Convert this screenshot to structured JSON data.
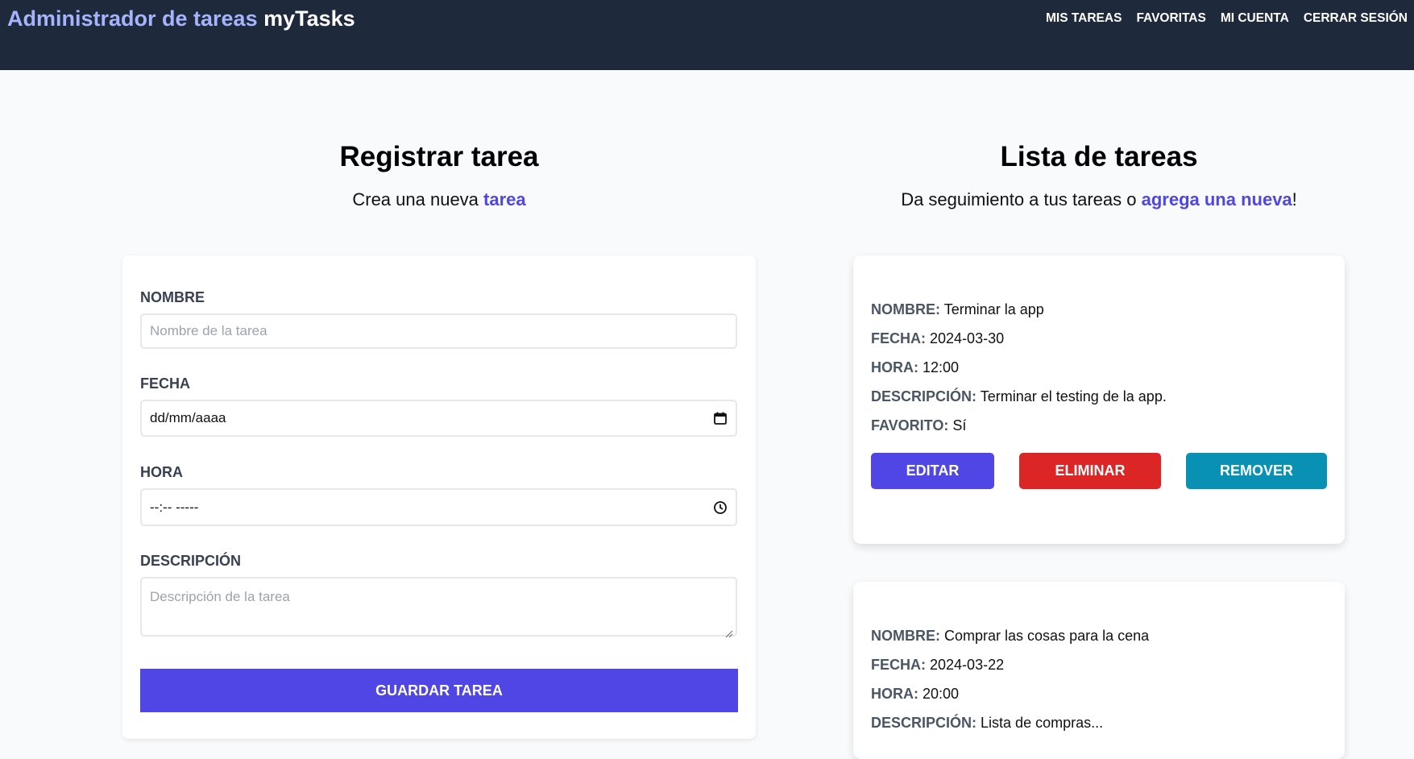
{
  "header": {
    "brand_prefix": "Administrador de tareas",
    "brand_name": "myTasks",
    "nav": [
      "Mis tareas",
      "Favoritas",
      "Mi cuenta",
      "Cerrar sesión"
    ]
  },
  "form_section": {
    "title": "Registrar tarea",
    "subtitle_prefix": "Crea una nueva",
    "subtitle_link": "tarea",
    "fields": {
      "name_label": "Nombre",
      "name_placeholder": "Nombre de la tarea",
      "date_label": "Fecha",
      "date_value": "dd/mm/aaaa",
      "time_label": "Hora",
      "time_value": "--:-- -----",
      "description_label": "Descripción",
      "description_placeholder": "Descripción de la tarea"
    },
    "save_label": "Guardar tarea"
  },
  "list_section": {
    "title": "Lista de tareas",
    "subtitle_prefix": "Da seguimiento a tus tareas o",
    "subtitle_link": "agrega una nueva",
    "subtitle_suffix": "!",
    "keys": {
      "name": "Nombre:",
      "date": "Fecha:",
      "time": "Hora:",
      "description": "Descripción:",
      "favorite": "Favorito:"
    },
    "tasks": [
      {
        "name": "Terminar la app",
        "date": "2024-03-30",
        "time": "12:00",
        "description": "Terminar el testing de la app.",
        "favorite": "Sí"
      },
      {
        "name": "Comprar las cosas para la cena",
        "date": "2024-03-22",
        "time": "20:00",
        "description": "Lista de compras..."
      }
    ],
    "buttons": {
      "edit": "Editar",
      "delete": "Eliminar",
      "remove": "Remover"
    }
  },
  "colors": {
    "header_bg": "#1e293b",
    "accent": "#4f46e5",
    "danger": "#dc2626",
    "info": "#0891b2"
  }
}
